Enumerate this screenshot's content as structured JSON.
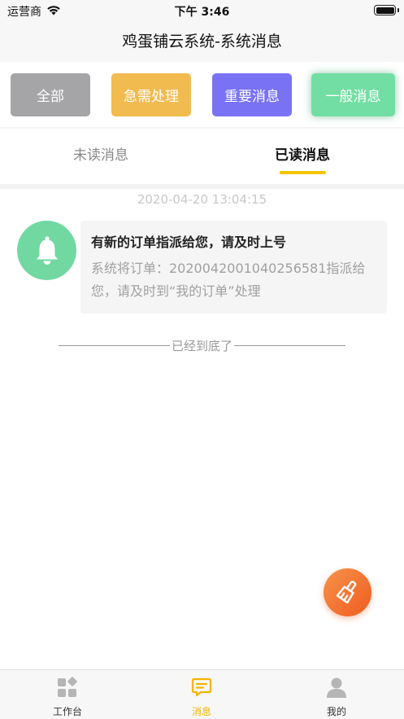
{
  "status_bar": {
    "carrier": "运营商",
    "time": "下午 3:46"
  },
  "nav": {
    "title": "鸡蛋铺云系统-系统消息"
  },
  "filters": [
    {
      "label": "全部",
      "color": "#a5a4a6"
    },
    {
      "label": "急需处理",
      "color": "#f1bb4f"
    },
    {
      "label": "重要消息",
      "color": "#7a72f5"
    },
    {
      "label": "一般消息",
      "color": "#73dea3",
      "selected": true
    }
  ],
  "tabs": [
    {
      "label": "未读消息",
      "active": false
    },
    {
      "label": "已读消息",
      "active": true
    }
  ],
  "messages": [
    {
      "time": "2020-04-20 13:04:15",
      "icon": "bell-icon",
      "title": "有新的订单指派给您，请及时上号",
      "body": "系统将订单：20200420010402565​81指派给您，请及时到“我的订单”处理"
    }
  ],
  "list_end_text": "已经到底了",
  "fab": {
    "icon": "brush-icon",
    "color": "#ef5c20"
  },
  "tab_bar": [
    {
      "label": "工作台",
      "icon": "grid-icon"
    },
    {
      "label": "消息",
      "icon": "message-icon",
      "active": true
    },
    {
      "label": "我的",
      "icon": "person-icon"
    }
  ],
  "colors": {
    "accent": "#f5c400",
    "active_tab_label": "#f4b400"
  }
}
